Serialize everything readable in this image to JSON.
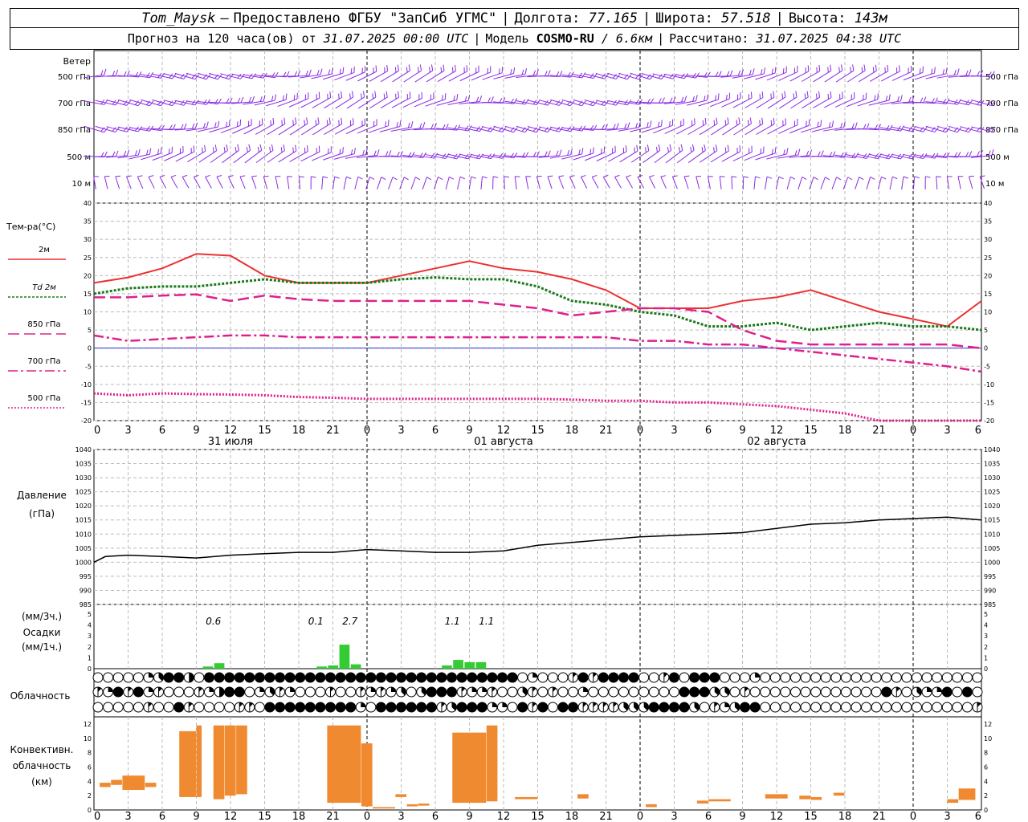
{
  "header": {
    "station": "Tom_Maysk",
    "dash": "–",
    "provided_by": "Предоставлено ФГБУ \"ЗапСиб УГМС\"",
    "sep": "|",
    "lon_label": "Долгота:",
    "lon_value": "77.165",
    "lat_label": "Широта:",
    "lat_value": "57.518",
    "alt_label": "Высота:",
    "alt_value": "143м",
    "forecast_prefix": "Прогноз на 120 часа(ов) от",
    "forecast_from": "31.07.2025 00:00 UTC",
    "model_label": "Модель",
    "model_name": "COSMO-RU",
    "model_res": "/ 6.6км",
    "calc_label": "Рассчитано:",
    "calc_time": "31.07.2025 04:38 UTC"
  },
  "colors": {
    "t2m": "#ee3030",
    "td2m": "#1a7a1a",
    "t850": "#e0208a",
    "t700": "#e0208a",
    "t500": "#e0208a",
    "pressure": "#000000",
    "precip": "#33cc33",
    "convective": "#f08a30",
    "wind": "#8a2be2",
    "zero_line": "#3333cc",
    "grid": "#bbbbbb"
  },
  "x_axis": {
    "tick_labels": [
      "0",
      "3",
      "6",
      "9",
      "12",
      "15",
      "18",
      "21",
      "0",
      "3",
      "6",
      "9",
      "12",
      "15",
      "18",
      "21",
      "0",
      "3",
      "6",
      "9",
      "12",
      "15",
      "18",
      "21",
      "0",
      "3",
      "6"
    ],
    "day_labels": [
      "31 июля",
      "01 августа",
      "02 августа"
    ]
  },
  "wind_panel": {
    "title": "Ветер",
    "levels": [
      "500 гПа",
      "700 гПа",
      "850 гПа",
      "500 м",
      "10 м"
    ]
  },
  "chart_data": [
    {
      "type": "line",
      "id": "temperature",
      "ylabel": "Тем-ра(°С)",
      "ylim": [
        -20,
        40
      ],
      "yticks": [
        "40",
        "35",
        "30",
        "25",
        "20",
        "15",
        "10",
        "5",
        "0",
        "-5",
        "-10",
        "-15",
        "-20"
      ],
      "x_hours": [
        0,
        3,
        6,
        9,
        12,
        15,
        18,
        21,
        24,
        27,
        30,
        33,
        36,
        39,
        42,
        45,
        48,
        51,
        54,
        57,
        60,
        63,
        66,
        69,
        72,
        75,
        78
      ],
      "series": [
        {
          "name": "2м",
          "values": [
            18,
            19.5,
            22,
            26,
            25.5,
            20,
            18,
            18,
            18,
            20,
            22,
            24,
            22,
            21,
            19,
            16,
            11,
            11,
            11,
            13,
            14,
            16,
            13,
            10,
            8,
            6,
            13
          ]
        },
        {
          "name": "Td 2м",
          "values": [
            15,
            16.5,
            17,
            17,
            18,
            19,
            18,
            18,
            18,
            19,
            19.5,
            19,
            19,
            17,
            13,
            12,
            10,
            9,
            6,
            6,
            7,
            5,
            6,
            7,
            6,
            6,
            5
          ]
        },
        {
          "name": "850 гПа",
          "values": [
            14,
            14,
            14.5,
            14.8,
            13,
            14.5,
            13.5,
            13,
            13,
            13,
            13,
            13,
            12,
            11,
            9,
            10,
            11,
            11,
            10,
            5,
            2,
            1,
            1,
            1,
            1,
            1,
            0
          ]
        },
        {
          "name": "700 гПа",
          "values": [
            3.5,
            2,
            2.5,
            3,
            3.5,
            3.5,
            3,
            3,
            3,
            3,
            3,
            3,
            3,
            3,
            3,
            3,
            2,
            2,
            1,
            1,
            0,
            -1,
            -2,
            -3,
            -4,
            -5,
            -6.5
          ]
        },
        {
          "name": "500 гПа",
          "values": [
            -12.5,
            -13,
            -12.5,
            -12.7,
            -12.8,
            -13,
            -13.5,
            -13.7,
            -14,
            -14,
            -14,
            -14,
            -14,
            -14,
            -14.2,
            -14.5,
            -14.5,
            -15,
            -15,
            -15.5,
            -16,
            -17,
            -18,
            -20,
            -21,
            -22,
            -23
          ]
        }
      ]
    },
    {
      "type": "line",
      "id": "pressure",
      "ylabel": "Давление",
      "ylabel2": "(гПа)",
      "ylim": [
        985,
        1040
      ],
      "yticks": [
        "1040",
        "1035",
        "1030",
        "1025",
        "1020",
        "1015",
        "1010",
        "1005",
        "1000",
        "995",
        "990",
        "985"
      ],
      "x_hours": [
        0,
        1,
        3,
        6,
        9,
        12,
        15,
        18,
        21,
        24,
        27,
        30,
        33,
        36,
        39,
        42,
        45,
        48,
        51,
        54,
        57,
        60,
        63,
        66,
        69,
        72,
        75,
        78
      ],
      "series": [
        {
          "name": "Давление",
          "values": [
            1000,
            1002,
            1002.5,
            1002,
            1001.5,
            1002.5,
            1003,
            1003.5,
            1003.5,
            1004.5,
            1004,
            1003.5,
            1003.5,
            1004,
            1006,
            1007,
            1008,
            1009,
            1009.5,
            1010,
            1010.5,
            1012,
            1013.5,
            1014,
            1015,
            1015.5,
            1016,
            1015
          ]
        }
      ]
    },
    {
      "type": "bar",
      "id": "precipitation",
      "ylabel": "Осадки",
      "ylabel_top": "(мм/3ч.)",
      "ylabel_bottom": "(мм/1ч.)",
      "ylim": [
        0,
        5
      ],
      "yticks": [
        "5",
        "4",
        "3",
        "2",
        "1",
        "0"
      ],
      "hourly_bars": [
        {
          "hour": 10,
          "value": 0.2
        },
        {
          "hour": 11,
          "value": 0.5
        },
        {
          "hour": 20,
          "value": 0.2
        },
        {
          "hour": 21,
          "value": 0.3
        },
        {
          "hour": 22,
          "value": 2.2
        },
        {
          "hour": 23,
          "value": 0.4
        },
        {
          "hour": 31,
          "value": 0.3
        },
        {
          "hour": 32,
          "value": 0.8
        },
        {
          "hour": 33,
          "value": 0.6
        },
        {
          "hour": 34,
          "value": 0.6
        }
      ],
      "totals": [
        {
          "hour": 10.5,
          "label": "0.6"
        },
        {
          "hour": 19.5,
          "label": "0.1"
        },
        {
          "hour": 22.5,
          "label": "2.7"
        },
        {
          "hour": 31.5,
          "label": "1.1"
        },
        {
          "hour": 34.5,
          "label": "1.1"
        }
      ]
    },
    {
      "type": "table",
      "id": "cloudiness",
      "ylabel": "Облачность",
      "rows": [
        "0000023884088888888888888888888888888888880200018188880018088800020000000000000000000000",
        "1281821000124880231200010012123038881221003101002000000000888330100000000000008103228080",
        "0000010081000011088888888820888888138882208180881111333888830123880000000000000000000001"
      ]
    },
    {
      "type": "bar",
      "id": "convective",
      "ylabel": "Конвективн.",
      "ylabel2": "облачность",
      "ylabel3": "(км)",
      "ylim": [
        0,
        13
      ],
      "yticks": [
        "12",
        "10",
        "8",
        "6",
        "4",
        "2",
        "0"
      ],
      "ranges": [
        {
          "x0": 0.5,
          "x1": 1.5,
          "bottom": 3.2,
          "top": 3.8
        },
        {
          "x0": 1.5,
          "x1": 2.5,
          "bottom": 3.5,
          "top": 4.2
        },
        {
          "x0": 2.5,
          "x1": 4.5,
          "bottom": 2.8,
          "top": 4.8
        },
        {
          "x0": 4.5,
          "x1": 5.5,
          "bottom": 3.2,
          "top": 3.8
        },
        {
          "x0": 7.5,
          "x1": 9.0,
          "bottom": 1.8,
          "top": 11.0
        },
        {
          "x0": 9.0,
          "x1": 9.5,
          "bottom": 1.8,
          "top": 11.8
        },
        {
          "x0": 10.5,
          "x1": 11.5,
          "bottom": 1.5,
          "top": 11.8
        },
        {
          "x0": 11.5,
          "x1": 12.5,
          "bottom": 2.0,
          "top": 11.8
        },
        {
          "x0": 12.5,
          "x1": 13.5,
          "bottom": 2.2,
          "top": 11.8
        },
        {
          "x0": 20.5,
          "x1": 23.5,
          "bottom": 1.0,
          "top": 11.8
        },
        {
          "x0": 23.5,
          "x1": 24.5,
          "bottom": 0.5,
          "top": 9.3
        },
        {
          "x0": 24.5,
          "x1": 26.5,
          "bottom": 0.2,
          "top": 0.4
        },
        {
          "x0": 26.5,
          "x1": 27.5,
          "bottom": 1.8,
          "top": 2.2
        },
        {
          "x0": 27.5,
          "x1": 28.5,
          "bottom": 0.5,
          "top": 0.8
        },
        {
          "x0": 28.5,
          "x1": 29.5,
          "bottom": 0.6,
          "top": 0.9
        },
        {
          "x0": 31.5,
          "x1": 34.5,
          "bottom": 1.0,
          "top": 10.8
        },
        {
          "x0": 34.5,
          "x1": 35.5,
          "bottom": 1.2,
          "top": 11.8
        },
        {
          "x0": 37.0,
          "x1": 39.0,
          "bottom": 1.5,
          "top": 1.8
        },
        {
          "x0": 42.5,
          "x1": 43.5,
          "bottom": 1.6,
          "top": 2.2
        },
        {
          "x0": 48.5,
          "x1": 49.5,
          "bottom": 0.4,
          "top": 0.8
        },
        {
          "x0": 53.0,
          "x1": 54.0,
          "bottom": 0.9,
          "top": 1.3
        },
        {
          "x0": 54.0,
          "x1": 56.0,
          "bottom": 1.2,
          "top": 1.5
        },
        {
          "x0": 59.0,
          "x1": 61.0,
          "bottom": 1.6,
          "top": 2.2
        },
        {
          "x0": 62.0,
          "x1": 63.0,
          "bottom": 1.5,
          "top": 2.0
        },
        {
          "x0": 63.0,
          "x1": 64.0,
          "bottom": 1.4,
          "top": 1.8
        },
        {
          "x0": 65.0,
          "x1": 66.0,
          "bottom": 2.0,
          "top": 2.4
        },
        {
          "x0": 75.0,
          "x1": 76.0,
          "bottom": 1.0,
          "top": 1.5
        },
        {
          "x0": 76.0,
          "x1": 77.5,
          "bottom": 1.4,
          "top": 3.0
        }
      ]
    }
  ]
}
